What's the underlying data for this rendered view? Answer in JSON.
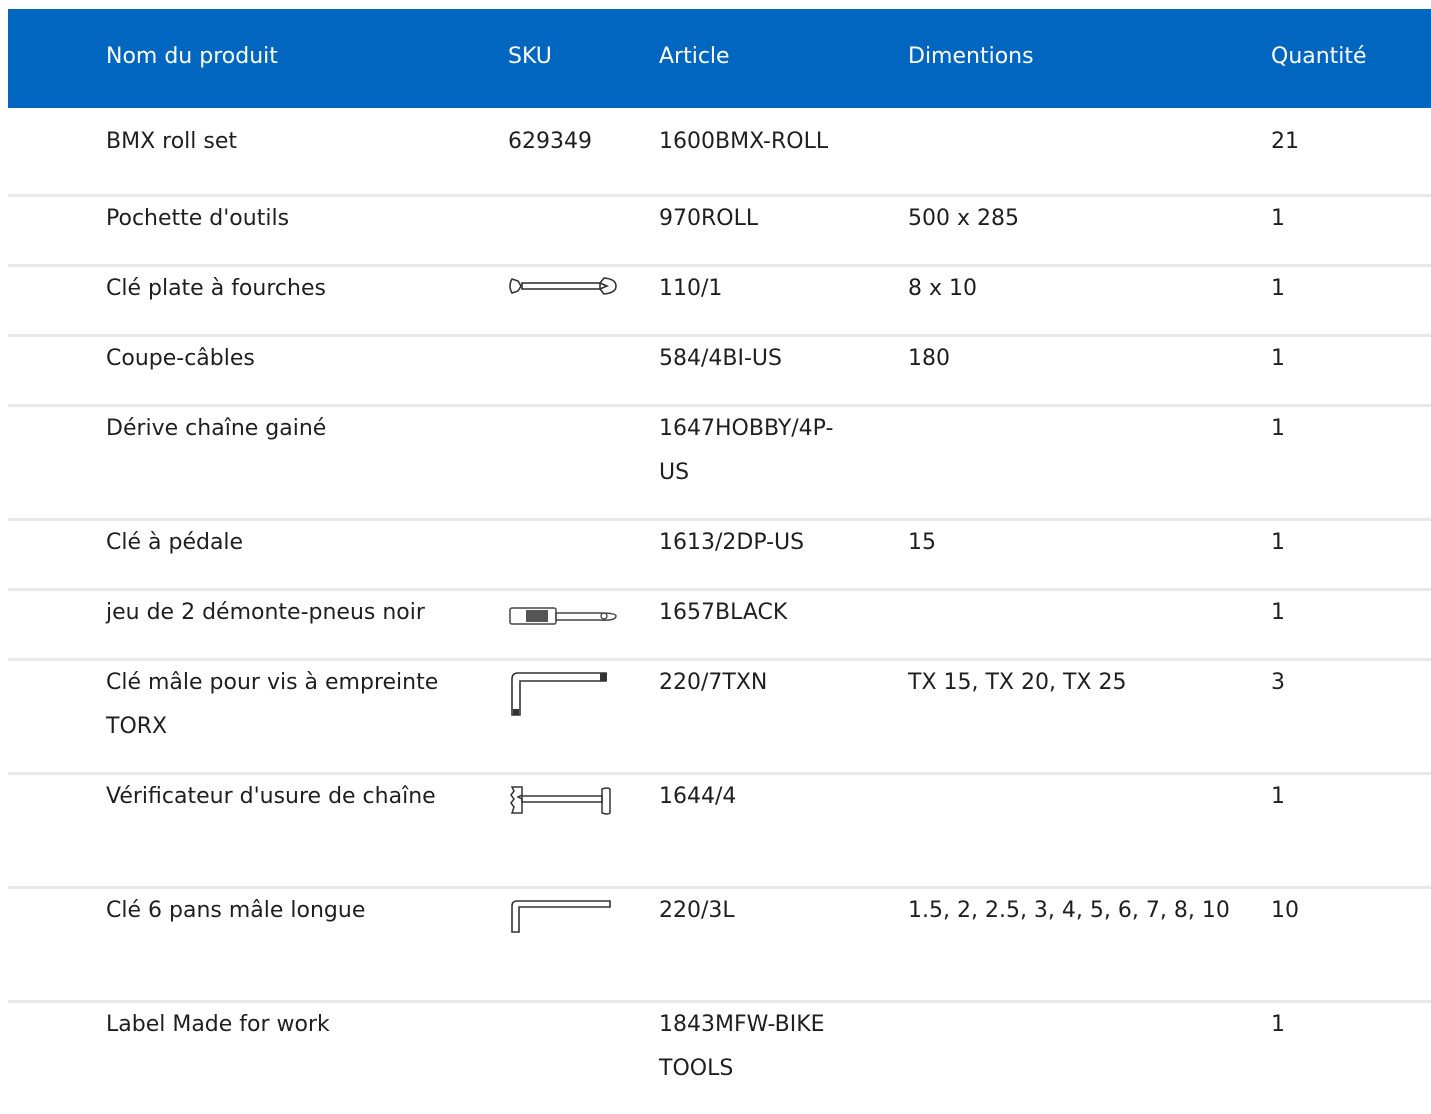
{
  "headers": {
    "name": "Nom du produit",
    "sku": "SKU",
    "article": "Article",
    "dimensions": "Dimentions",
    "quantity": "Quantité"
  },
  "rows": [
    {
      "name": "BMX roll set",
      "sku": "629349",
      "article": "1600BMX-ROLL",
      "dimensions": "",
      "quantity": "21",
      "icon": ""
    },
    {
      "name": "Pochette d'outils",
      "sku": "",
      "article": "970ROLL",
      "dimensions": "500 x 285",
      "quantity": "1",
      "icon": ""
    },
    {
      "name": "Clé plate à fourches",
      "sku": "",
      "article": "110/1",
      "dimensions": "8 x 10",
      "quantity": "1",
      "icon": "open-end-wrench-icon"
    },
    {
      "name": "Coupe-câbles",
      "sku": "",
      "article": "584/4BI-US",
      "dimensions": "180",
      "quantity": "1",
      "icon": ""
    },
    {
      "name": "Dérive chaîne gainé",
      "sku": "",
      "article": "1647HOBBY/4P-US",
      "dimensions": "",
      "quantity": "1",
      "icon": ""
    },
    {
      "name": "Clé à pédale",
      "sku": "",
      "article": "1613/2DP-US",
      "dimensions": "15",
      "quantity": "1",
      "icon": ""
    },
    {
      "name": "jeu de 2 démonte-pneus noir",
      "sku": "",
      "article": "1657BLACK",
      "dimensions": "",
      "quantity": "1",
      "icon": "tire-lever-icon"
    },
    {
      "name": "Clé mâle pour vis à empreinte TORX",
      "sku": "",
      "article": "220/7TXN",
      "dimensions": "TX 15, TX 20, TX 25",
      "quantity": "3",
      "icon": "torx-key-icon"
    },
    {
      "name": "Vérificateur d'usure de chaîne",
      "sku": "",
      "article": "1644/4",
      "dimensions": "",
      "quantity": "1",
      "icon": "chain-checker-icon"
    },
    {
      "name": "Clé 6 pans mâle longue",
      "sku": "",
      "article": "220/3L",
      "dimensions": "1.5, 2, 2.5, 3, 4, 5, 6, 7, 8, 10",
      "quantity": "10",
      "icon": "hex-key-icon"
    },
    {
      "name": "Label Made for work",
      "sku": "",
      "article": "1843MFW-BIKE TOOLS",
      "dimensions": "",
      "quantity": "1",
      "icon": ""
    }
  ]
}
